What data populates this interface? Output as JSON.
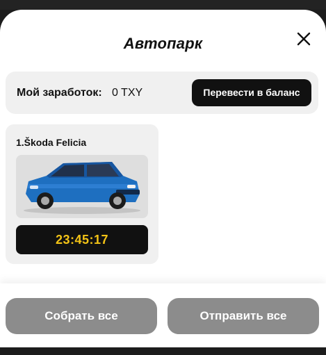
{
  "modal": {
    "title": "Автопарк",
    "close_icon": "close-icon"
  },
  "earnings": {
    "label": "Мой заработок:",
    "value": "0 TXY",
    "transfer_button": "Перевести в баланс"
  },
  "cars": [
    {
      "name": "1.Škoda Felicia",
      "image_color": "#1e6fc0",
      "timer": "23:45:17"
    }
  ],
  "footer": {
    "collect_all": "Собрать все",
    "send_all": "Отправить все"
  },
  "colors": {
    "timer_text": "#f3c316",
    "primary_button": "#111111",
    "footer_button": "#8c8c8c"
  }
}
